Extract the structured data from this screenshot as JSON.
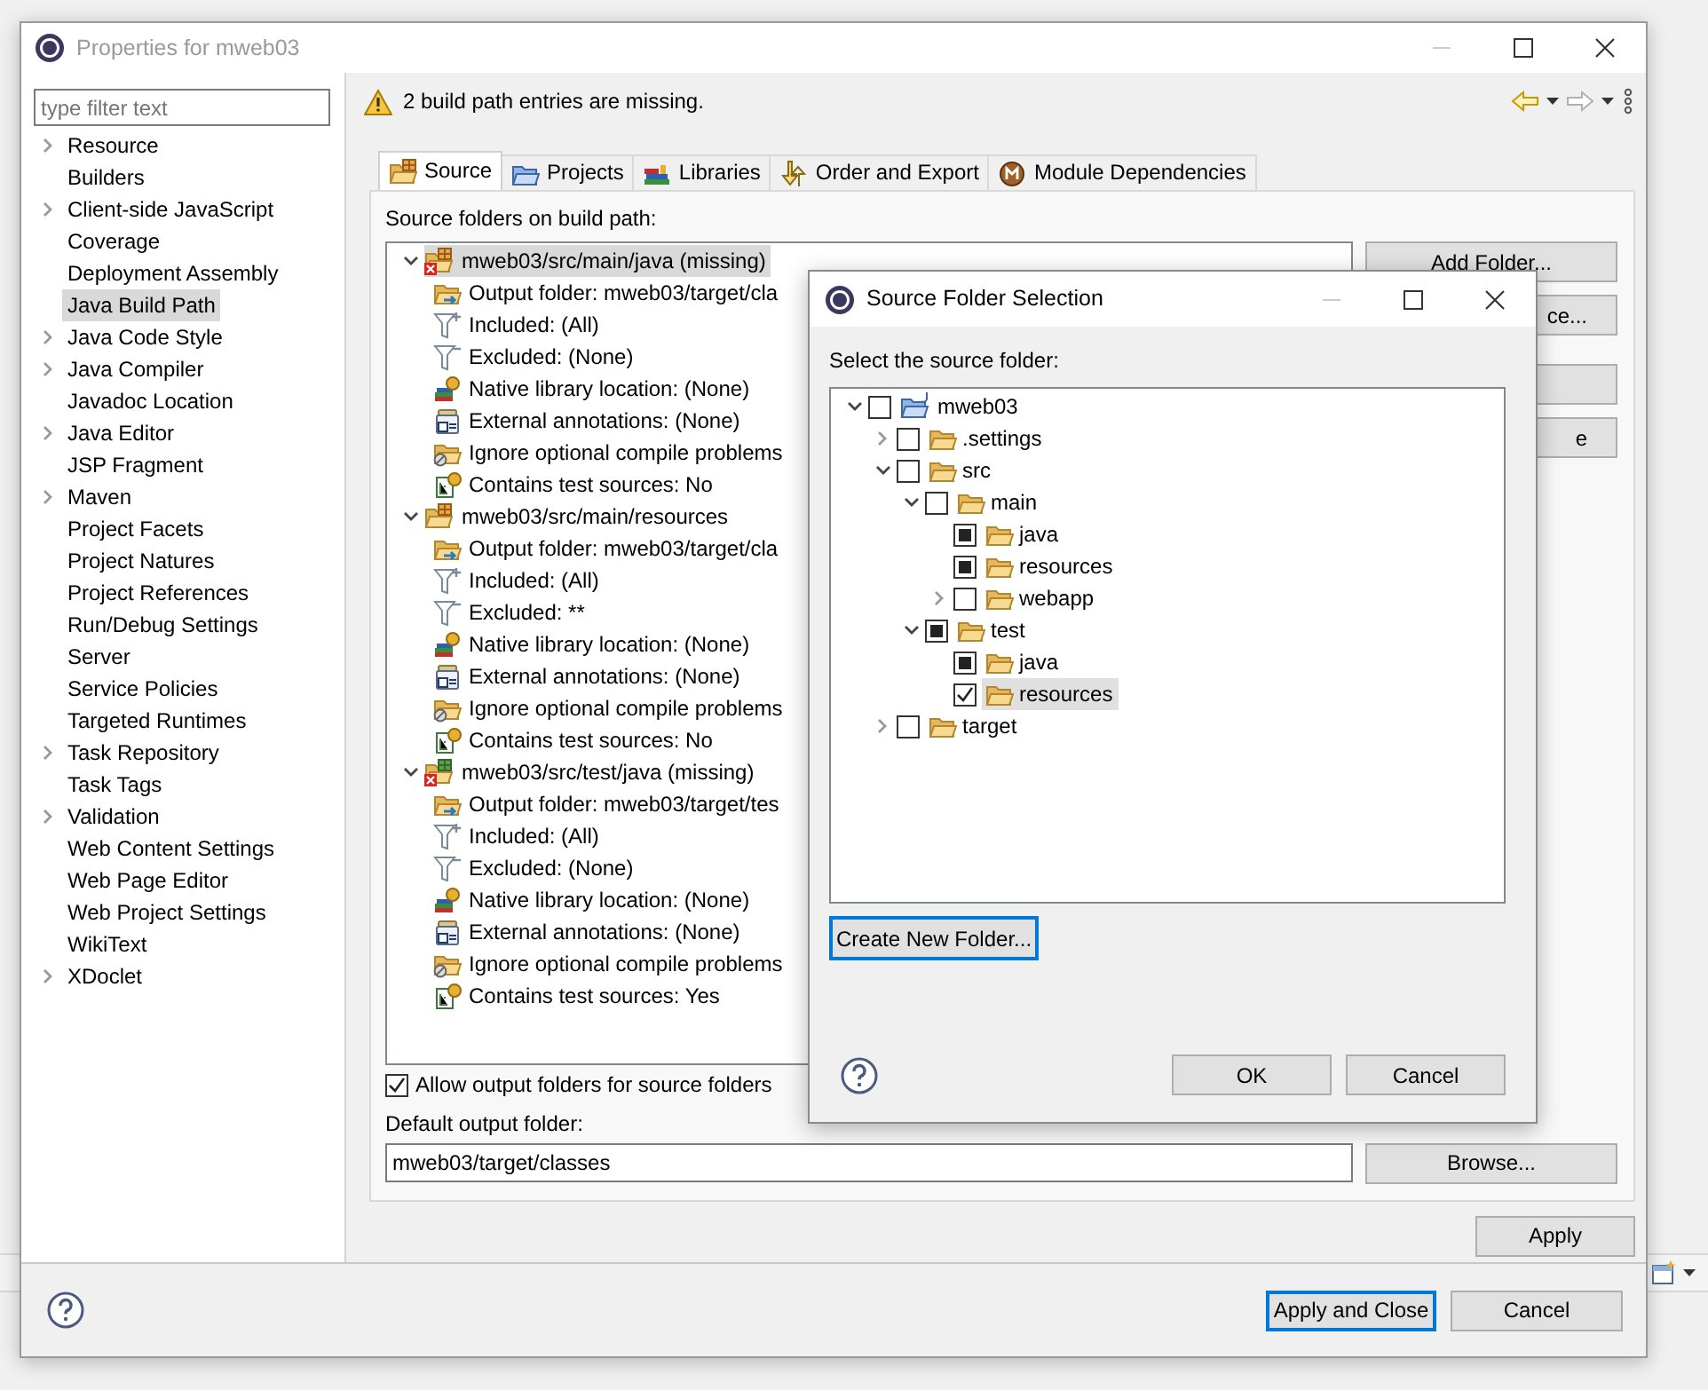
{
  "window": {
    "title": "Properties for mweb03"
  },
  "filter": {
    "placeholder": "type filter text"
  },
  "categories": [
    {
      "label": "Resource",
      "expandable": true,
      "selected": false
    },
    {
      "label": "Builders",
      "expandable": false,
      "selected": false
    },
    {
      "label": "Client-side JavaScript",
      "expandable": true,
      "selected": false
    },
    {
      "label": "Coverage",
      "expandable": false,
      "selected": false
    },
    {
      "label": "Deployment Assembly",
      "expandable": false,
      "selected": false
    },
    {
      "label": "Java Build Path",
      "expandable": false,
      "selected": true
    },
    {
      "label": "Java Code Style",
      "expandable": true,
      "selected": false
    },
    {
      "label": "Java Compiler",
      "expandable": true,
      "selected": false
    },
    {
      "label": "Javadoc Location",
      "expandable": false,
      "selected": false
    },
    {
      "label": "Java Editor",
      "expandable": true,
      "selected": false
    },
    {
      "label": "JSP Fragment",
      "expandable": false,
      "selected": false
    },
    {
      "label": "Maven",
      "expandable": true,
      "selected": false
    },
    {
      "label": "Project Facets",
      "expandable": false,
      "selected": false
    },
    {
      "label": "Project Natures",
      "expandable": false,
      "selected": false
    },
    {
      "label": "Project References",
      "expandable": false,
      "selected": false
    },
    {
      "label": "Run/Debug Settings",
      "expandable": false,
      "selected": false
    },
    {
      "label": "Server",
      "expandable": false,
      "selected": false
    },
    {
      "label": "Service Policies",
      "expandable": false,
      "selected": false
    },
    {
      "label": "Targeted Runtimes",
      "expandable": false,
      "selected": false
    },
    {
      "label": "Task Repository",
      "expandable": true,
      "selected": false
    },
    {
      "label": "Task Tags",
      "expandable": false,
      "selected": false
    },
    {
      "label": "Validation",
      "expandable": true,
      "selected": false
    },
    {
      "label": "Web Content Settings",
      "expandable": false,
      "selected": false
    },
    {
      "label": "Web Page Editor",
      "expandable": false,
      "selected": false
    },
    {
      "label": "Web Project Settings",
      "expandable": false,
      "selected": false
    },
    {
      "label": "WikiText",
      "expandable": false,
      "selected": false
    },
    {
      "label": "XDoclet",
      "expandable": true,
      "selected": false
    }
  ],
  "message": {
    "text": "2 build path entries are missing."
  },
  "tabs": [
    {
      "label": "Source",
      "kind": "source",
      "selected": true
    },
    {
      "label": "Projects",
      "kind": "projects",
      "selected": false
    },
    {
      "label": "Libraries",
      "kind": "libraries",
      "selected": false
    },
    {
      "label": "Order and Export",
      "kind": "order",
      "selected": false
    },
    {
      "label": "Module Dependencies",
      "kind": "modules",
      "selected": false
    }
  ],
  "source": {
    "heading": "Source folders on build path:",
    "entries": [
      {
        "label": "mweb03/src/main/java (missing)",
        "kind": "main",
        "missing": true,
        "expanded": true,
        "selected": true,
        "children": [
          {
            "label": "Output folder: mweb03/target/cla",
            "kind": "output"
          },
          {
            "label": "Included: (All)",
            "kind": "included"
          },
          {
            "label": "Excluded: (None)",
            "kind": "excluded"
          },
          {
            "label": "Native library location: (None)",
            "kind": "native"
          },
          {
            "label": "External annotations: (None)",
            "kind": "annotations"
          },
          {
            "label": "Ignore optional compile problems",
            "kind": "ignore"
          },
          {
            "label": "Contains test sources: No",
            "kind": "tests"
          }
        ]
      },
      {
        "label": "mweb03/src/main/resources",
        "kind": "main",
        "missing": false,
        "expanded": true,
        "selected": false,
        "children": [
          {
            "label": "Output folder: mweb03/target/cla",
            "kind": "output"
          },
          {
            "label": "Included: (All)",
            "kind": "included"
          },
          {
            "label": "Excluded: **",
            "kind": "excluded"
          },
          {
            "label": "Native library location: (None)",
            "kind": "native"
          },
          {
            "label": "External annotations: (None)",
            "kind": "annotations"
          },
          {
            "label": "Ignore optional compile problems",
            "kind": "ignore"
          },
          {
            "label": "Contains test sources: No",
            "kind": "tests"
          }
        ]
      },
      {
        "label": "mweb03/src/test/java (missing)",
        "kind": "test",
        "missing": true,
        "expanded": true,
        "selected": false,
        "children": [
          {
            "label": "Output folder: mweb03/target/tes",
            "kind": "output"
          },
          {
            "label": "Included: (All)",
            "kind": "included"
          },
          {
            "label": "Excluded: (None)",
            "kind": "excluded"
          },
          {
            "label": "Native library location: (None)",
            "kind": "native"
          },
          {
            "label": "External annotations: (None)",
            "kind": "annotations"
          },
          {
            "label": "Ignore optional compile problems",
            "kind": "ignore"
          },
          {
            "label": "Contains test sources: Yes",
            "kind": "tests"
          }
        ]
      }
    ],
    "buttons": [
      {
        "kind": "labeled",
        "label": "Add Folder..."
      },
      {
        "kind": "labeled",
        "label": "ce..."
      },
      {
        "kind": "blank"
      },
      {
        "kind": "labeled",
        "label": "e"
      }
    ],
    "allow_output": {
      "label": "Allow output folders for source folders",
      "checked": true
    },
    "default_output": {
      "label": "Default output folder:",
      "value": "mweb03/target/classes"
    },
    "browse": "Browse..."
  },
  "apply": "Apply",
  "footer": {
    "apply_close": "Apply and Close",
    "cancel": "Cancel"
  },
  "dialog": {
    "title": "Source Folder Selection",
    "prompt": "Select the source folder:",
    "tree": [
      {
        "label": "mweb03",
        "kind": "project",
        "checked": false,
        "expanded": true,
        "selected": false,
        "children": [
          {
            "label": ".settings",
            "kind": "folder",
            "checked": false,
            "expanded": false,
            "selected": false
          },
          {
            "label": "src",
            "kind": "folder",
            "checked": false,
            "expanded": true,
            "selected": false,
            "children": [
              {
                "label": "main",
                "kind": "folder",
                "checked": false,
                "expanded": true,
                "selected": false,
                "children": [
                  {
                    "label": "java",
                    "kind": "folder",
                    "checked": true,
                    "grayed": true,
                    "selected": false
                  },
                  {
                    "label": "resources",
                    "kind": "folder",
                    "checked": true,
                    "grayed": true,
                    "selected": false
                  },
                  {
                    "label": "webapp",
                    "kind": "folder",
                    "checked": false,
                    "expanded": false,
                    "selected": false
                  }
                ]
              },
              {
                "label": "test",
                "kind": "folder",
                "checked": true,
                "grayed": true,
                "expanded": true,
                "selected": false,
                "children": [
                  {
                    "label": "java",
                    "kind": "folder",
                    "checked": true,
                    "grayed": true,
                    "selected": false
                  },
                  {
                    "label": "resources",
                    "kind": "folder",
                    "checked": true,
                    "selected": true
                  }
                ]
              }
            ]
          },
          {
            "label": "target",
            "kind": "folder",
            "checked": false,
            "expanded": false,
            "selected": false
          }
        ]
      }
    ],
    "create_button": "Create New Folder...",
    "ok": "OK",
    "cancel": "Cancel"
  }
}
